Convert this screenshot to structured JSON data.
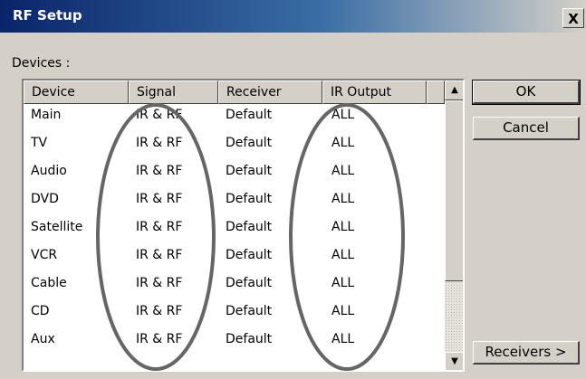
{
  "window": {
    "title": "RF Setup",
    "close_label": "X"
  },
  "devices_label": "Devices :",
  "table": {
    "columns": [
      "Device",
      "Signal",
      "Receiver",
      "IR Output"
    ],
    "rows": [
      [
        "Main",
        "IR & RF",
        "Default",
        "ALL"
      ],
      [
        "TV",
        "IR & RF",
        "Default",
        "ALL"
      ],
      [
        "Audio",
        "IR & RF",
        "Default",
        "ALL"
      ],
      [
        "DVD",
        "IR & RF",
        "Default",
        "ALL"
      ],
      [
        "Satellite",
        "IR & RF",
        "Default",
        "ALL"
      ],
      [
        "VCR",
        "IR & RF",
        "Default",
        "ALL"
      ],
      [
        "Cable",
        "IR & RF",
        "Default",
        "ALL"
      ],
      [
        "CD",
        "IR & RF",
        "Default",
        "ALL"
      ],
      [
        "Aux",
        "IR & RF",
        "Default",
        "ALL"
      ]
    ]
  },
  "scrollbar": {
    "up_icon": "scroll-up-arrow-icon",
    "down_icon": "scroll-down-arrow-icon"
  },
  "buttons": {
    "ok": "OK",
    "cancel": "Cancel",
    "receivers": "Receivers >"
  },
  "annotation": {
    "color": "#666666",
    "shape": "ellipse"
  }
}
